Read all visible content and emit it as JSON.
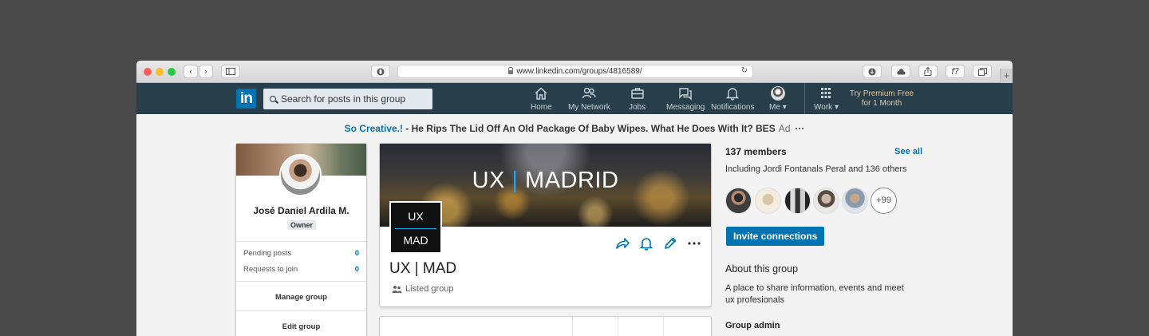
{
  "browser": {
    "url": "www.linkedin.com/groups/4816589/"
  },
  "nav": {
    "search_placeholder": "Search for posts in this group",
    "items": [
      {
        "label": "Home",
        "icon": "home-icon"
      },
      {
        "label": "My Network",
        "icon": "network-icon"
      },
      {
        "label": "Jobs",
        "icon": "briefcase-icon"
      },
      {
        "label": "Messaging",
        "icon": "messaging-icon"
      },
      {
        "label": "Notifications",
        "icon": "bell-icon"
      },
      {
        "label": "Me",
        "icon": "avatar"
      },
      {
        "label": "Work",
        "icon": "grid-icon"
      }
    ],
    "premium_line1": "Try Premium Free",
    "premium_line2": "for 1 Month",
    "logo_text": "in"
  },
  "ad": {
    "brand": "So Creative.!",
    "text": " - He Rips The Lid Off An Old Package Of Baby Wipes. What He Does With It? BES",
    "label": "Ad",
    "more": "···"
  },
  "profile": {
    "name": "José Daniel Ardila M.",
    "role": "Owner",
    "pending_label": "Pending posts",
    "pending_count": "0",
    "requests_label": "Requests to join",
    "requests_count": "0",
    "manage": "Manage group",
    "edit": "Edit group"
  },
  "group": {
    "banner_left": "UX",
    "banner_sep": "|",
    "banner_right": "MADRID",
    "logo_top": "UX",
    "logo_bottom": "MAD",
    "name": "UX | MAD",
    "visibility": "Listed group"
  },
  "members": {
    "heading": "137 members",
    "see_all": "See all",
    "including": "Including Jordi Fontanals Peral and 136 others",
    "more": "+99",
    "invite": "Invite connections"
  },
  "about": {
    "heading": "About this group",
    "text": "A place to share information, events and meet ux profesionals",
    "admin_heading": "Group admin"
  },
  "colors": {
    "nav_bg": "#283e4a",
    "brand_blue": "#0073b1",
    "premium_gold": "#e7c995"
  }
}
